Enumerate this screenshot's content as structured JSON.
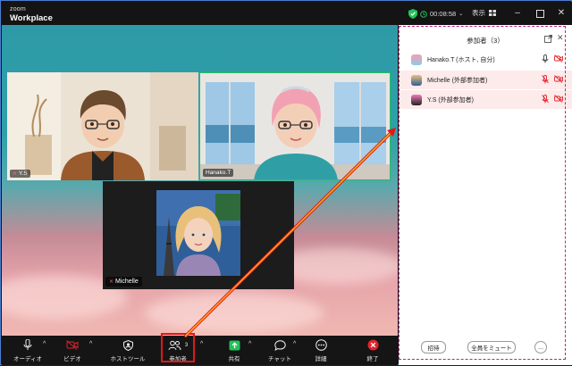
{
  "app": {
    "brand_small": "zoom",
    "brand_large": "Workplace"
  },
  "titlebar": {
    "timer": "00:08:58",
    "view_label": "表示"
  },
  "participants": {
    "yo": {
      "name": "Y.S"
    },
    "hanako": {
      "name": "Hanako.T"
    },
    "michelle": {
      "name": "Michelle"
    }
  },
  "toolbar": {
    "audio": "オーディオ",
    "video": "ビデオ",
    "host_tools": "ホストツール",
    "participants": "参加者",
    "participants_count": "3",
    "share": "共有",
    "chat": "チャット",
    "more": "詳細",
    "end": "終了"
  },
  "panel": {
    "title": "参加者（3）",
    "rows": [
      {
        "name": "Hanako.T (ホスト, 自分)",
        "muted": false
      },
      {
        "name": "Michelle (外部参加者)",
        "muted": true
      },
      {
        "name": "Y.S (外部参加者)",
        "muted": true
      }
    ],
    "invite_label": "招待",
    "mute_all_label": "全員をミュート",
    "more_label": "…"
  },
  "colors": {
    "accent_green": "#22c35a",
    "annotation_red": "#e01818",
    "annotation_magenta": "#c0208a",
    "end_red": "#e0242b"
  }
}
